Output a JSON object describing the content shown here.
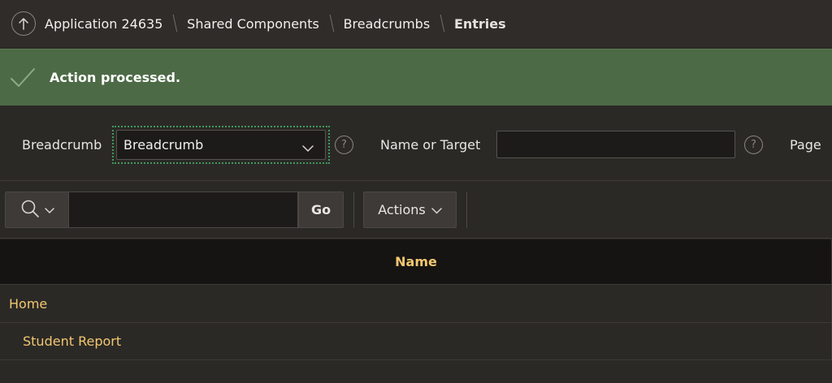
{
  "breadcrumb": {
    "items": [
      "Application 24635",
      "Shared Components",
      "Breadcrumbs"
    ],
    "current": "Entries"
  },
  "banner": {
    "message": "Action processed."
  },
  "filters": {
    "breadcrumb_label": "Breadcrumb",
    "breadcrumb_value": "Breadcrumb",
    "name_target_label": "Name or Target",
    "name_target_value": "",
    "page_label": "Page",
    "help_glyph": "?"
  },
  "toolbar": {
    "search_value": "",
    "go_label": "Go",
    "actions_label": "Actions"
  },
  "table": {
    "columns": [
      "Name"
    ],
    "rows": [
      {
        "name": "Home",
        "level": 0
      },
      {
        "name": "Student Report",
        "level": 1
      }
    ]
  },
  "colors": {
    "banner_bg": "#4d6a46",
    "link": "#f2c770",
    "focus_ring": "#3f9a5c"
  }
}
